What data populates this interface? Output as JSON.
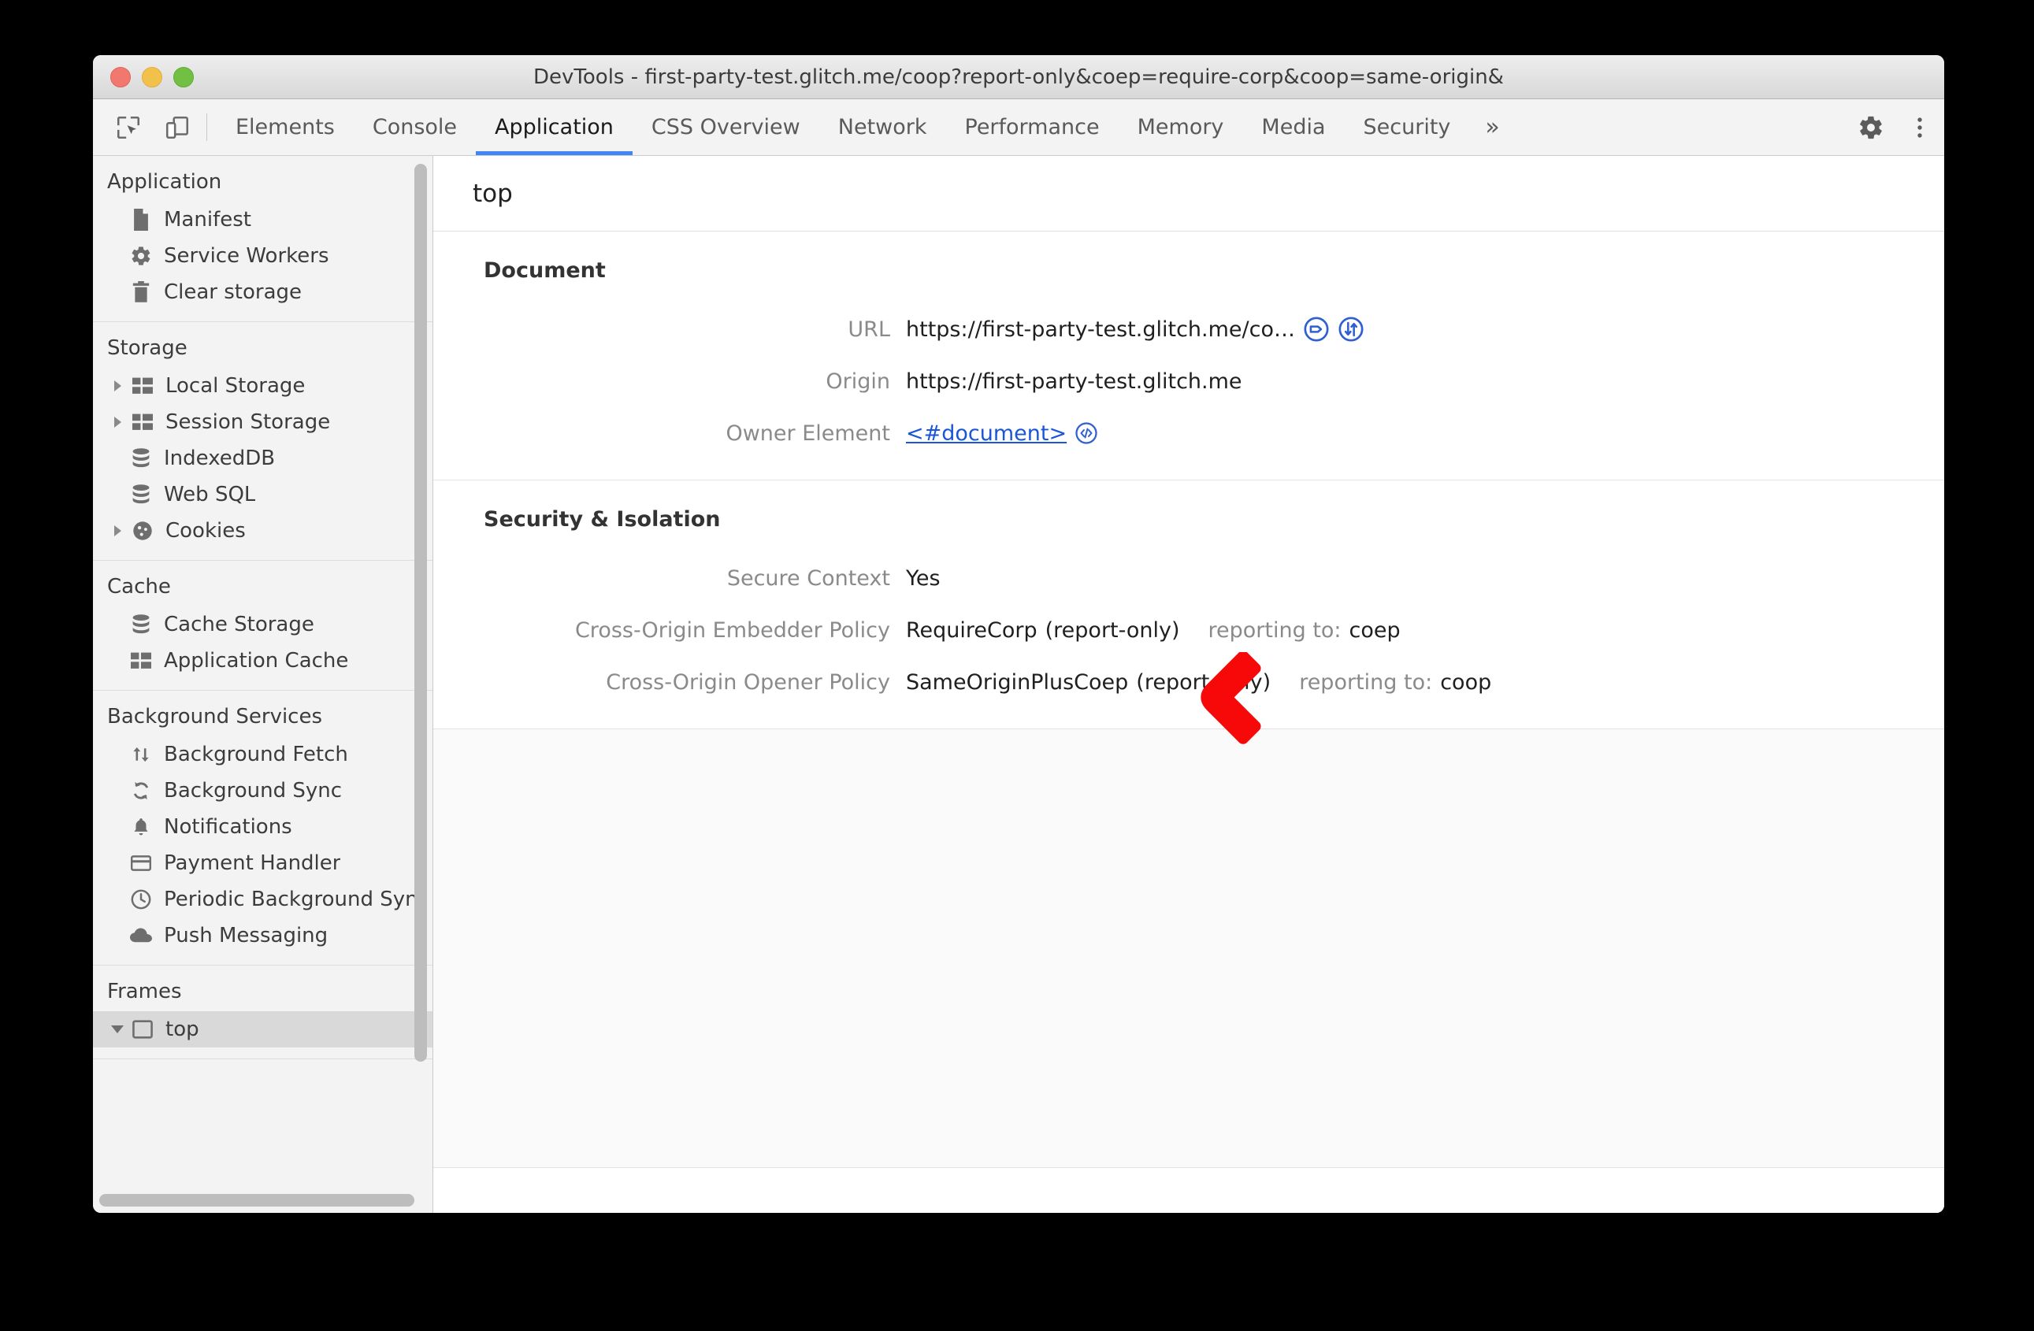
{
  "window": {
    "title": "DevTools - first-party-test.glitch.me/coop?report-only&coep=require-corp&coop=same-origin&",
    "controls": [
      "close",
      "minimize",
      "zoom"
    ]
  },
  "toolbar": {
    "inspect_icon": "inspect-cursor-icon",
    "device_icon": "device-toolbar-icon",
    "tabs": [
      {
        "label": "Elements",
        "active": false
      },
      {
        "label": "Console",
        "active": false
      },
      {
        "label": "Application",
        "active": true
      },
      {
        "label": "CSS Overview",
        "active": false
      },
      {
        "label": "Network",
        "active": false
      },
      {
        "label": "Performance",
        "active": false
      },
      {
        "label": "Memory",
        "active": false
      },
      {
        "label": "Media",
        "active": false
      },
      {
        "label": "Security",
        "active": false
      }
    ],
    "more_tabs_label": "»",
    "settings_icon": "gear-icon",
    "menu_icon": "kebab-menu-icon",
    "active_tab_color": "#4285f4"
  },
  "sidebar": {
    "sections": [
      {
        "title": "Application",
        "items": [
          {
            "label": "Manifest",
            "icon": "document-icon",
            "arrow": "none"
          },
          {
            "label": "Service Workers",
            "icon": "gear-icon",
            "arrow": "none"
          },
          {
            "label": "Clear storage",
            "icon": "trash-icon",
            "arrow": "none"
          }
        ]
      },
      {
        "title": "Storage",
        "items": [
          {
            "label": "Local Storage",
            "icon": "table-icon",
            "arrow": "collapsed"
          },
          {
            "label": "Session Storage",
            "icon": "table-icon",
            "arrow": "collapsed"
          },
          {
            "label": "IndexedDB",
            "icon": "database-icon",
            "arrow": "none"
          },
          {
            "label": "Web SQL",
            "icon": "database-icon",
            "arrow": "none"
          },
          {
            "label": "Cookies",
            "icon": "cookie-icon",
            "arrow": "collapsed"
          }
        ]
      },
      {
        "title": "Cache",
        "items": [
          {
            "label": "Cache Storage",
            "icon": "database-icon",
            "arrow": "none"
          },
          {
            "label": "Application Cache",
            "icon": "table-icon",
            "arrow": "none"
          }
        ]
      },
      {
        "title": "Background Services",
        "items": [
          {
            "label": "Background Fetch",
            "icon": "updown-arrows-icon",
            "arrow": "none"
          },
          {
            "label": "Background Sync",
            "icon": "sync-icon",
            "arrow": "none"
          },
          {
            "label": "Notifications",
            "icon": "bell-icon",
            "arrow": "none"
          },
          {
            "label": "Payment Handler",
            "icon": "credit-card-icon",
            "arrow": "none"
          },
          {
            "label": "Periodic Background Syn",
            "icon": "clock-icon",
            "arrow": "none"
          },
          {
            "label": "Push Messaging",
            "icon": "cloud-icon",
            "arrow": "none"
          }
        ]
      },
      {
        "title": "Frames",
        "items": [
          {
            "label": "top",
            "icon": "frame-icon",
            "arrow": "expanded",
            "selected": true
          }
        ]
      }
    ]
  },
  "main": {
    "frame_title": "top",
    "document_section": {
      "title": "Document",
      "rows": [
        {
          "label": "URL",
          "value": "https://first-party-test.glitch.me/co…",
          "icons": [
            "tag-circle-icon",
            "network-arrows-circle-icon"
          ]
        },
        {
          "label": "Origin",
          "value": "https://first-party-test.glitch.me",
          "icons": []
        },
        {
          "label": "Owner Element",
          "value": "<#document>",
          "link": true,
          "icons": [
            "code-circle-icon"
          ]
        }
      ]
    },
    "security_section": {
      "title": "Security & Isolation",
      "rows": [
        {
          "label": "Secure Context",
          "value": "Yes"
        },
        {
          "label": "Cross-Origin Embedder Policy",
          "value": "RequireCorp",
          "state": "(report-only)",
          "reporting_label": "reporting to:",
          "reporting_value": "coep"
        },
        {
          "label": "Cross-Origin Opener Policy",
          "value": "SameOriginPlusCoep",
          "state": "(report-only)",
          "reporting_label": "reporting to:",
          "reporting_value": "coop"
        }
      ]
    }
  },
  "annotation": {
    "arrow_color": "#f70909",
    "points_to": "Cross-Origin Embedder Policy value"
  }
}
